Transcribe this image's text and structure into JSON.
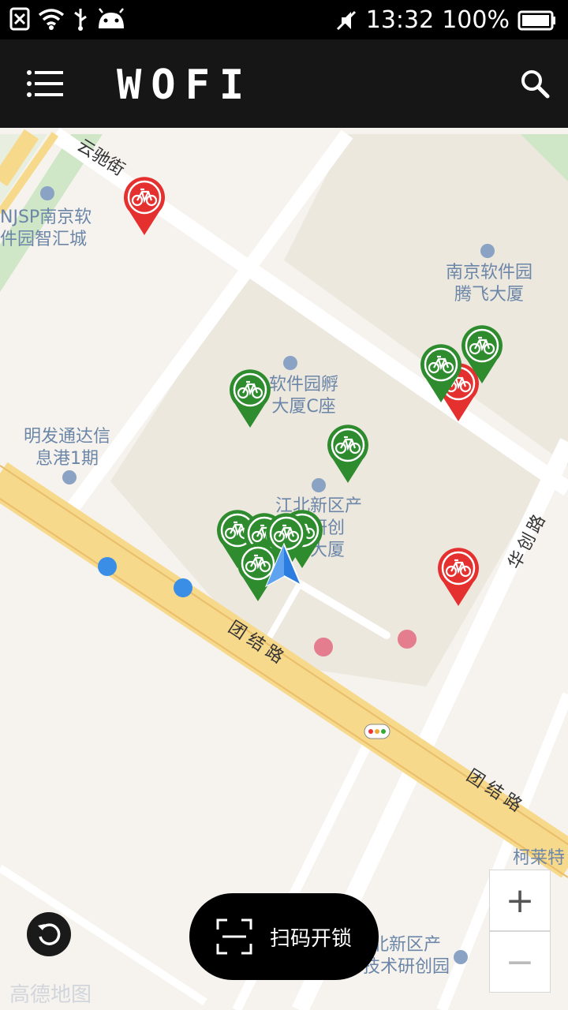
{
  "status_bar": {
    "time": "13:32",
    "battery": "100%",
    "icons": [
      "sim-off-icon",
      "wifi-icon",
      "usb-icon",
      "android-icon",
      "mute-icon",
      "battery-icon"
    ]
  },
  "app_bar": {
    "logo": "WOFI",
    "menu_icon": "menu-icon",
    "search_icon": "search-icon"
  },
  "map": {
    "poi_labels": [
      {
        "id": "njsp",
        "text": "NJSP南京软\n件园智汇城"
      },
      {
        "id": "tengfei",
        "text": "南京软件园\n腾飞大厦"
      },
      {
        "id": "fuhua",
        "text": "软件园孵\n大厦C座"
      },
      {
        "id": "mingfa",
        "text": "明发通达信\n息港1期"
      },
      {
        "id": "jiangbei",
        "text": "江北新区产\n术研创\n鹰大厦"
      },
      {
        "id": "kelai",
        "text": "柯莱特"
      },
      {
        "id": "jiangbei2",
        "text": "北新区产\n技术研创园"
      }
    ],
    "road_labels": [
      {
        "id": "yunchi",
        "text": "云驰街"
      },
      {
        "id": "tuanjie1",
        "text": "团结路"
      },
      {
        "id": "huachuang",
        "text": "华创路"
      },
      {
        "id": "tuanjie2",
        "text": "团结路"
      }
    ],
    "bike_status_colors": {
      "available": "#2e8b2e",
      "unavailable": "#e53030"
    },
    "bikes": [
      {
        "status": "unavailable"
      },
      {
        "status": "available"
      },
      {
        "status": "unavailable"
      },
      {
        "status": "available"
      },
      {
        "status": "available"
      },
      {
        "status": "available"
      },
      {
        "status": "available"
      },
      {
        "status": "available"
      },
      {
        "status": "available"
      },
      {
        "status": "available"
      },
      {
        "status": "available"
      },
      {
        "status": "unavailable"
      }
    ],
    "zoom_in_label": "+",
    "zoom_out_label": "−",
    "watermark": "高德地图"
  },
  "scan_button": {
    "label": "扫码开锁",
    "icon": "scan-icon"
  },
  "relocate_icon": "refresh-icon"
}
